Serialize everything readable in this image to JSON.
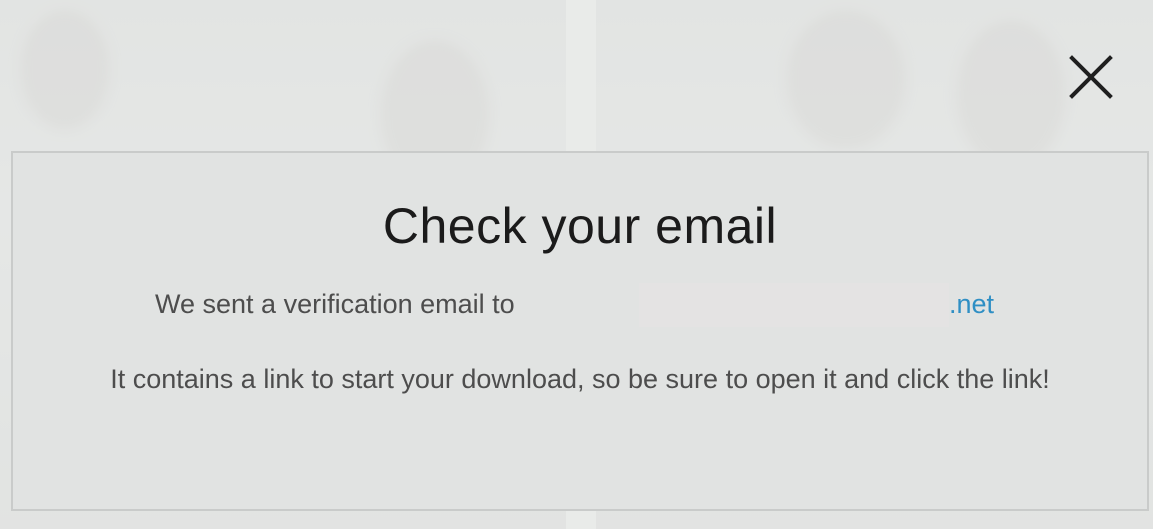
{
  "modal": {
    "title": "Check your email",
    "sent_text": "We sent a verification email to",
    "email_domain": ".net",
    "info_text": "It contains a link to start your download, so be sure to open it and click the link!"
  },
  "close_button": {
    "icon": "close-icon"
  },
  "colors": {
    "link": "#2f8fc4",
    "title": "#1b1b1b",
    "body_text": "#4d4d4d",
    "modal_bg": "#e1e3e2"
  }
}
